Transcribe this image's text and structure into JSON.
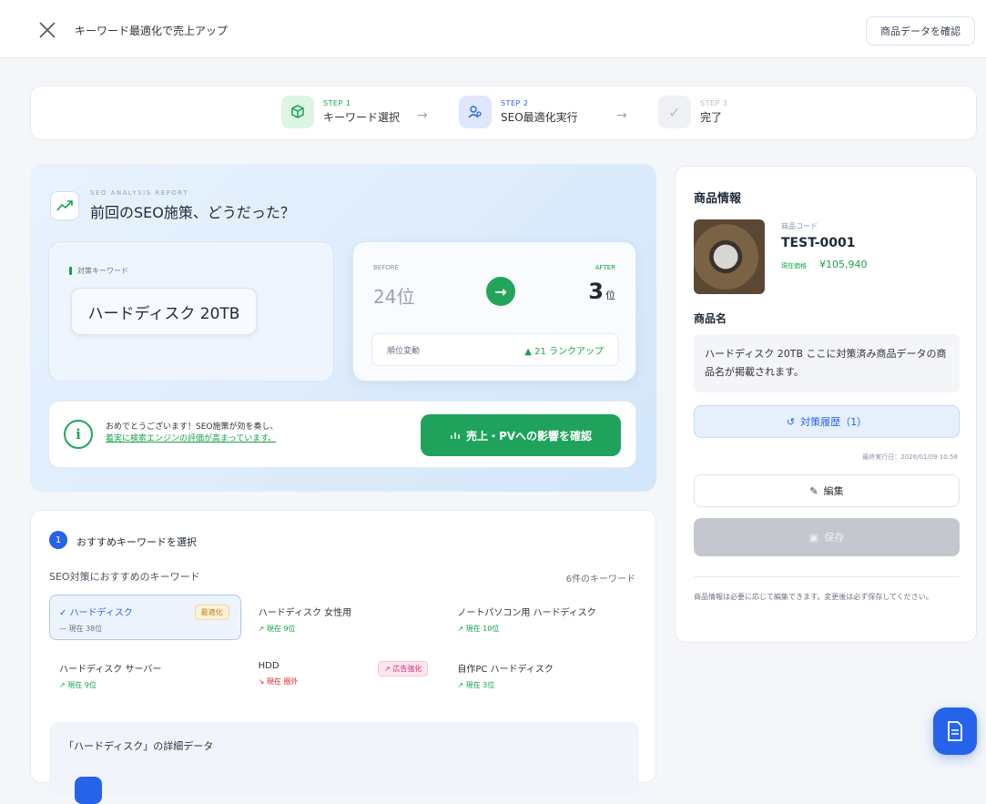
{
  "header": {
    "title": "キーワード最適化で売上アップ",
    "confirm_button": "商品データを確認"
  },
  "stepper": {
    "steps": [
      {
        "small": "STEP 1",
        "label": "キーワード選択",
        "state": "done"
      },
      {
        "small": "STEP 2",
        "label": "SEO最適化実行",
        "state": "active"
      },
      {
        "small": "STEP 3",
        "label": "完了",
        "state": "pending"
      }
    ],
    "arrow": "→"
  },
  "report": {
    "eyebrow": "SEO ANALYSIS REPORT",
    "title": "前回のSEO施策、どうだった？",
    "keyword_tag": "対策キーワード",
    "keyword": "ハードディスク 20TB",
    "before_label": "BEFORE",
    "before_rank": "24位",
    "after_label": "AFTER",
    "after_rank": "3",
    "after_unit": "位",
    "change_label": "順位変動",
    "change_value": "▲ 21 ランクアップ",
    "notice_line1": "おめでとうございます！SEO施策が効を奏し、",
    "notice_line2": "着実に検索エンジンの評価が高まっています。",
    "notice_button": "売上・PVへの影響を確認"
  },
  "keywords": {
    "step_number": "1",
    "heading": "おすすめキーワードを選択",
    "subheading": "SEO対策におすすめのキーワード",
    "count": "6件のキーワード",
    "items": [
      {
        "name": "✓ ハードディスク",
        "rank": "— 現在 38位",
        "trend": "flat",
        "badge": "最適化"
      },
      {
        "name": "ハードディスク 女性用",
        "rank": "↗ 現在 9位",
        "trend": "up",
        "badge": ""
      },
      {
        "name": "ノートパソコン用 ハードディスク",
        "rank": "↗ 現在 10位",
        "trend": "up",
        "badge": ""
      },
      {
        "name": "ハードディスク サーバー",
        "rank": "↗ 現在 9位",
        "trend": "up",
        "badge": ""
      },
      {
        "name": "HDD",
        "rank": "↘ 現在 圏外",
        "trend": "down",
        "badge": "↗ 広告強化"
      },
      {
        "name": "自作PC ハードディスク",
        "rank": "↗ 現在 3位",
        "trend": "up",
        "badge": ""
      }
    ],
    "detail_title": "「ハードディスク」の詳細データ"
  },
  "product": {
    "section_title": "商品情報",
    "code_label": "商品コード",
    "code": "TEST-0001",
    "price_label": "現在価格",
    "price": "¥105,940",
    "name_label": "商品名",
    "name_text": "ハードディスク 20TB ここに対策済み商品データの商品名が掲載されます。",
    "history_button": "対策履歴（1）",
    "last_run": "最終実行日：2026/01/09 10:58",
    "edit_button": "編集",
    "save_button": "保存",
    "note": "商品情報は必要に応じて編集できます。変更後は必ず保存してください。"
  },
  "colors": {
    "accent_green": "#1fa35c",
    "accent_blue": "#2563eb",
    "badge_recent": "#c08520",
    "badge_drop": "#db2777"
  }
}
